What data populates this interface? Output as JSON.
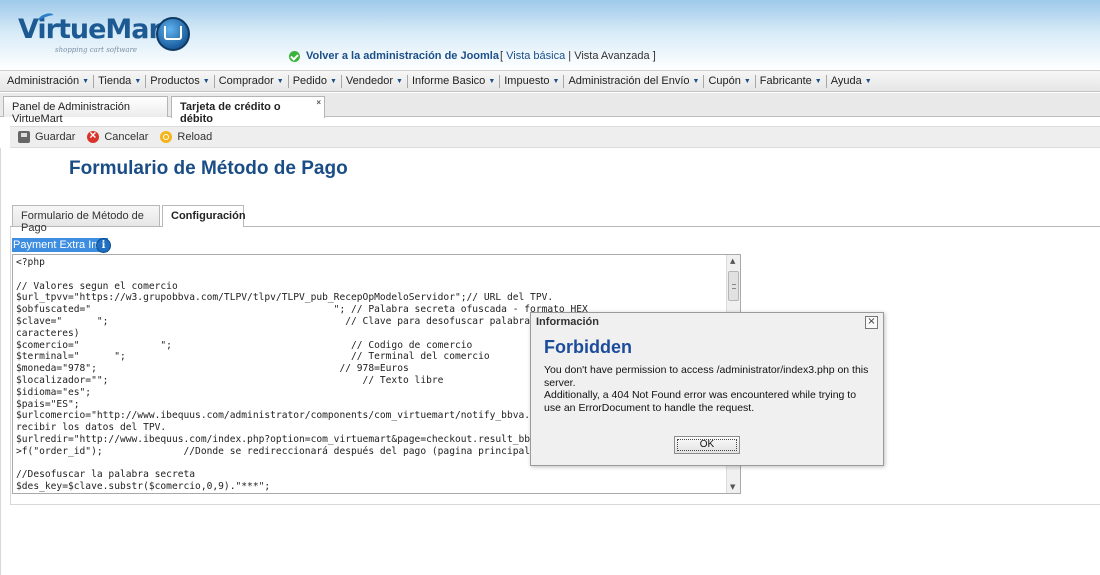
{
  "header": {
    "logo_text": "VirtueMart",
    "logo_subtitle": "shopping cart software",
    "joomla_link": "Volver a la administración de Joomla",
    "view_basic": "Vista básica",
    "view_separator": "|",
    "view_advanced": "Vista Avanzada",
    "bracket_open": "[",
    "bracket_close": "]"
  },
  "menu": {
    "items": [
      {
        "label": "Administración"
      },
      {
        "label": "Tienda"
      },
      {
        "label": "Productos"
      },
      {
        "label": "Comprador"
      },
      {
        "label": "Pedido"
      },
      {
        "label": "Vendedor"
      },
      {
        "label": "Informe Basico"
      },
      {
        "label": "Impuesto"
      },
      {
        "label": "Administración del Envío"
      },
      {
        "label": "Cupón"
      },
      {
        "label": "Fabricante"
      },
      {
        "label": "Ayuda"
      }
    ],
    "caret": "▼"
  },
  "page_tabs": {
    "tab1": "Panel de Administración VirtueMart",
    "tab2": "Tarjeta de crédito o débito",
    "close_glyph": "×"
  },
  "toolbar": {
    "save_label": "Guardar",
    "cancel_label": "Cancelar",
    "reload_label": "Reload"
  },
  "page_title": "Formulario de Método de Pago",
  "content_tabs": {
    "tab1": "Formulario de Método de Pago",
    "tab2": "Configuración"
  },
  "extra_info": {
    "label": "Payment Extra Info",
    "info_glyph": "i"
  },
  "code_lines": [
    "<?php",
    "",
    "// Valores segun el comercio",
    "$url_tpvv=\"https://w3.grupobbva.com/TLPV/tlpv/TLPV_pub_RecepOpModeloServidor\";// URL del TPV.",
    "$obfuscated=\"                                          \"; // Palabra secreta ofuscada - formato HEX",
    "$clave=\"      \";                                         // Clave para desofuscar palabra secreta (8",
    "caracteres)",
    "$comercio=\"              \";                               // Codigo de comercio",
    "$terminal=\"      \";                                       // Terminal del comercio",
    "$moneda=\"978\";                                          // 978=Euros",
    "$localizador=\"\";                                            // Texto libre",
    "$idioma=\"es\";",
    "$pais=\"ES\";",
    "$urlcomercio=\"http://www.ibequus.com/administrator/components/com_virtuemart/notify_bbva.php\";",
    "recibir los datos del TPV.",
    "$urlredir=\"http://www.ibequus.com/index.php?option=com_virtuemart&page=checkout.result_bbva&order_id=\".$db-",
    ">f(\"order_id\");              //Donde se redireccionará después del pago (pagina principal por ejemplo)",
    "",
    "//Desofuscar la palabra secreta",
    "$des_key=$clave.substr($comercio,0,9).\"***\";"
  ],
  "dialog": {
    "title": "Información",
    "close_glyph": "×",
    "heading": "Forbidden",
    "line1": "You don't have permission to access /administrator/index3.php on this server.",
    "line2": "Additionally, a 404 Not Found error was encountered while trying to use an ErrorDocument to handle the request.",
    "ok_label": "OK"
  }
}
